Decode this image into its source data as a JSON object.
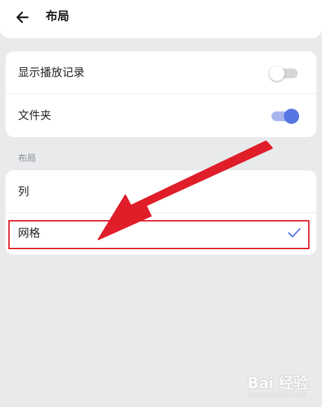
{
  "header": {
    "title": "布局"
  },
  "settings": [
    {
      "label": "显示播放记录",
      "toggle_on": false
    },
    {
      "label": "文件夹",
      "toggle_on": true
    }
  ],
  "layout_section": {
    "label": "布局",
    "options": [
      {
        "label": "列",
        "selected": false
      },
      {
        "label": "网格",
        "selected": true
      }
    ]
  },
  "colors": {
    "accent": "#5677e1",
    "toggle_on_track": "#a9b6ee",
    "annotation_red": "#e01e2a",
    "background": "#e9eaec"
  },
  "icons": {
    "back": "arrow-left-icon",
    "selected": "checkmark-icon"
  },
  "watermark": {
    "text": "Bai  经验",
    "subtext": "jingyan.baidu.com"
  }
}
